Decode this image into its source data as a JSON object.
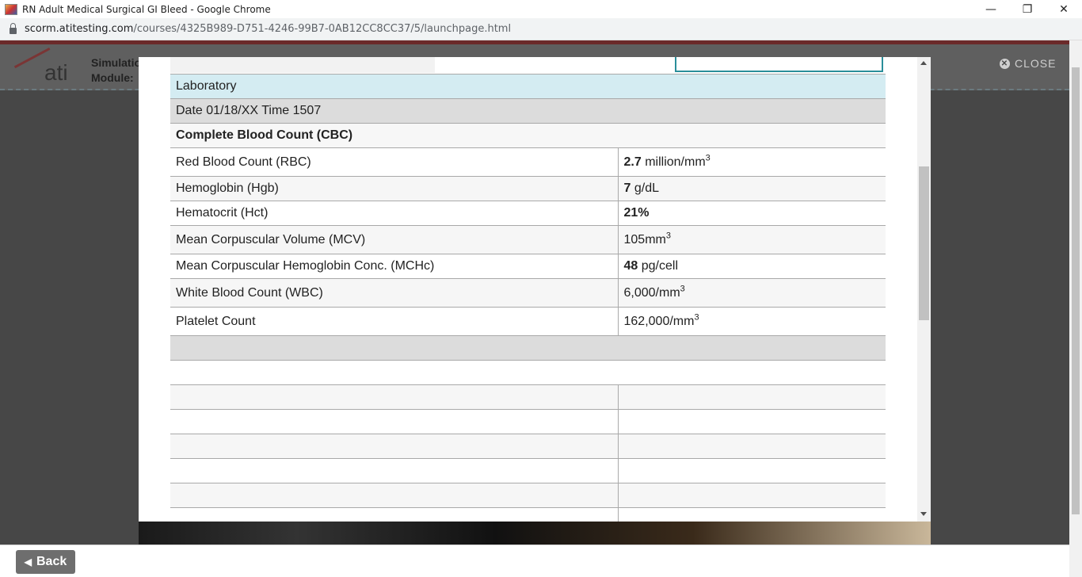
{
  "browser": {
    "window_title": "RN Adult Medical Surgical GI Bleed - Google Chrome",
    "url_host": "scorm.atitesting.com",
    "url_path": "/courses/4325B989-D751-4246-99B7-0AB12CC8CC37/5/launchpage.html",
    "minimize": "—",
    "restore": "❐",
    "close": "✕"
  },
  "app": {
    "logo_text": "ati",
    "sim_line1": "Simulation",
    "sim_line2": "Module:",
    "close_label": "CLOSE",
    "back_label": "Back"
  },
  "lab": {
    "header": "Laboratory",
    "date_line": "Date 01/18/XX Time 1507",
    "section": "Complete Blood Count (CBC)",
    "rows": [
      {
        "name": "Red Blood Count (RBC)",
        "value_bold": "2.7",
        "value_rest": " million/mm",
        "sup": "3"
      },
      {
        "name": "Hemoglobin (Hgb)",
        "value_bold": "7",
        "value_rest": " g/dL",
        "sup": ""
      },
      {
        "name": "Hematocrit (Hct)",
        "value_bold": "21%",
        "value_rest": "",
        "sup": ""
      },
      {
        "name": "Mean Corpuscular Volume (MCV)",
        "value_bold": "",
        "value_rest": "105mm",
        "sup": "3"
      },
      {
        "name": "Mean Corpuscular Hemoglobin Conc. (MCHc)",
        "value_bold": "48",
        "value_rest": " pg/cell",
        "sup": ""
      },
      {
        "name": "White Blood Count (WBC)",
        "value_bold": "",
        "value_rest": "6,000/mm",
        "sup": "3"
      },
      {
        "name": "Platelet Count",
        "value_bold": "",
        "value_rest": "162,000/mm",
        "sup": "3"
      }
    ]
  }
}
